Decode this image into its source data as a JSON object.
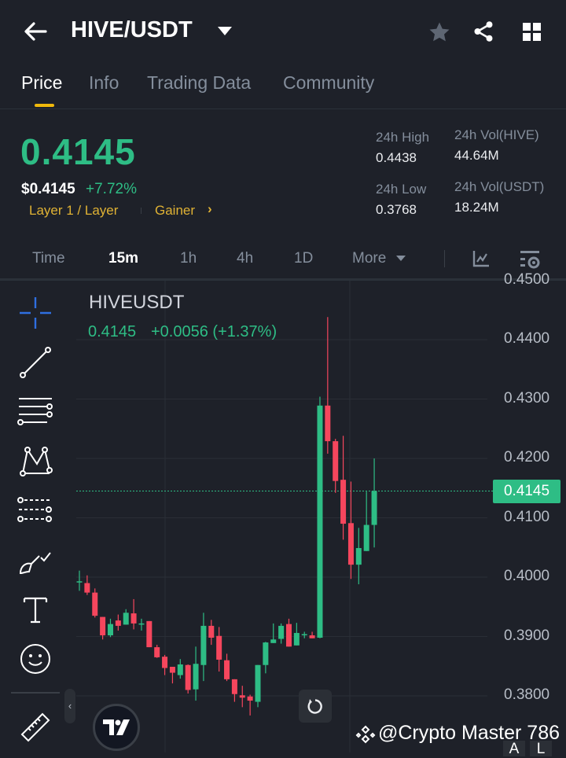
{
  "header": {
    "title": "HIVE/USDT"
  },
  "tabs": [
    {
      "label": "Price"
    },
    {
      "label": "Info"
    },
    {
      "label": "Trading Data"
    },
    {
      "label": "Community"
    }
  ],
  "ticker": {
    "last_price": "0.4145",
    "usd_price": "$0.4145",
    "change_pct": "+7.72%",
    "tag1": "Layer 1 / Layer",
    "tag2": "Gainer",
    "tag2_arrow": "›",
    "high_label": "24h High",
    "high": "0.4438",
    "low_label": "24h Low",
    "low": "0.3768",
    "vol_base_label": "24h Vol(HIVE)",
    "vol_base": "44.64M",
    "vol_quote_label": "24h Vol(USDT)",
    "vol_quote": "18.24M"
  },
  "intervals": [
    {
      "label": "Time"
    },
    {
      "label": "15m"
    },
    {
      "label": "1h"
    },
    {
      "label": "4h"
    },
    {
      "label": "1D"
    },
    {
      "label": "More"
    }
  ],
  "chart": {
    "symbol": "HIVEUSDT",
    "ohlc_last": "0.4145",
    "ohlc_change": "+0.0056 (+1.37%)",
    "current_label": "0.4145",
    "current_price": 0.4145,
    "axis_labels": [
      "0.4500",
      "0.4400",
      "0.4300",
      "0.4200",
      "0.4100",
      "0.4000",
      "0.3900",
      "0.3800"
    ],
    "colors": {
      "up": "#2ebd85",
      "down": "#f6465d"
    }
  },
  "chart_data": {
    "type": "candlestick",
    "interval": "15m",
    "ylim": [
      0.3767,
      0.4505
    ],
    "candles": [
      [
        0.3993,
        0.4011,
        0.3977,
        0.3993
      ],
      [
        0.399,
        0.4003,
        0.397,
        0.3974
      ],
      [
        0.3974,
        0.3981,
        0.3932,
        0.3935
      ],
      [
        0.3933,
        0.3933,
        0.3895,
        0.3902
      ],
      [
        0.3902,
        0.393,
        0.3899,
        0.3921
      ],
      [
        0.3927,
        0.3937,
        0.391,
        0.3918
      ],
      [
        0.392,
        0.3946,
        0.392,
        0.394
      ],
      [
        0.3939,
        0.3963,
        0.3912,
        0.3922
      ],
      [
        0.3922,
        0.393,
        0.391,
        0.3922
      ],
      [
        0.3926,
        0.3926,
        0.3882,
        0.3882
      ],
      [
        0.3882,
        0.3886,
        0.3864,
        0.3865
      ],
      [
        0.3866,
        0.3869,
        0.3835,
        0.3847
      ],
      [
        0.3849,
        0.3849,
        0.3821,
        0.3839
      ],
      [
        0.3835,
        0.3862,
        0.3829,
        0.3853
      ],
      [
        0.3852,
        0.3853,
        0.3804,
        0.381
      ],
      [
        0.3811,
        0.3883,
        0.3792,
        0.3854
      ],
      [
        0.3852,
        0.394,
        0.3825,
        0.3918
      ],
      [
        0.3918,
        0.3928,
        0.3886,
        0.3898
      ],
      [
        0.3901,
        0.3916,
        0.3841,
        0.3861
      ],
      [
        0.386,
        0.3871,
        0.3825,
        0.3828
      ],
      [
        0.3828,
        0.3828,
        0.379,
        0.3803
      ],
      [
        0.3801,
        0.3817,
        0.3781,
        0.3797
      ],
      [
        0.3799,
        0.3802,
        0.3767,
        0.3792
      ],
      [
        0.379,
        0.3852,
        0.3781,
        0.3852
      ],
      [
        0.3852,
        0.3891,
        0.3838,
        0.389
      ],
      [
        0.3889,
        0.3922,
        0.3889,
        0.3895
      ],
      [
        0.3896,
        0.3922,
        0.3888,
        0.3918
      ],
      [
        0.3921,
        0.393,
        0.3883,
        0.3883
      ],
      [
        0.3885,
        0.3923,
        0.3885,
        0.3906
      ],
      [
        0.3904,
        0.3908,
        0.3897,
        0.3904
      ],
      [
        0.3902,
        0.3908,
        0.3897,
        0.3897
      ],
      [
        0.3898,
        0.4304,
        0.3897,
        0.4289
      ],
      [
        0.4289,
        0.4438,
        0.4208,
        0.4229
      ],
      [
        0.4229,
        0.4233,
        0.4142,
        0.4162
      ],
      [
        0.4164,
        0.4238,
        0.4063,
        0.409
      ],
      [
        0.4091,
        0.4161,
        0.3997,
        0.4021
      ],
      [
        0.4021,
        0.4083,
        0.3988,
        0.4049
      ],
      [
        0.4044,
        0.4144,
        0.4044,
        0.4088
      ],
      [
        0.4088,
        0.42,
        0.405,
        0.4145
      ]
    ]
  },
  "watermark": "@Crypto Master 786",
  "corner_buttons": [
    "A",
    "L"
  ]
}
